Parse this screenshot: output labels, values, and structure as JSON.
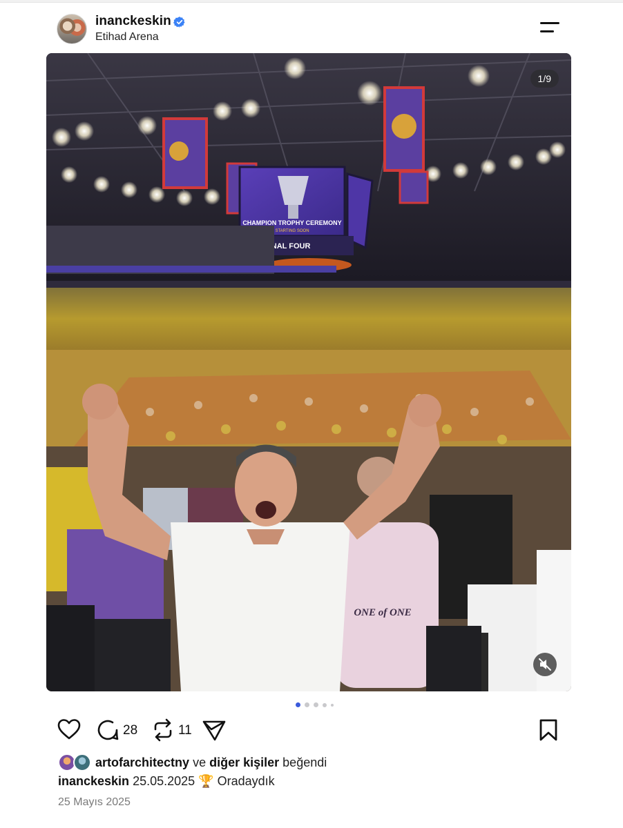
{
  "post": {
    "username": "inanckeskin",
    "location": "Etihad Arena",
    "verified": true,
    "media_counter": "1/9",
    "scoreboard_text": "CHAMPION TROPHY CEREMONY",
    "scoreboard_subtext": "STARTING SOON",
    "final_four_text": "FINAL FOUR",
    "shirt_text": "ONE of ONE",
    "carousel_active_index": 0,
    "carousel_dot_count": 5
  },
  "actions": {
    "like_icon": "heart-icon",
    "comment_icon": "comment-icon",
    "comment_count": "28",
    "repost_icon": "repost-icon",
    "repost_count": "11",
    "share_icon": "send-icon",
    "save_icon": "bookmark-icon"
  },
  "likes": {
    "first_user": "artofarchitectny",
    "connector": "ve",
    "others": "diğer kişiler",
    "suffix": "beğendi"
  },
  "caption": {
    "author": "inanckeskin",
    "text_before": "25.05.2025",
    "emoji": "🏆",
    "text_after": "Oradaydık"
  },
  "date_label": "25 Mayıs 2025",
  "colors": {
    "verified_blue": "#3b82f6",
    "active_dot": "#3b5bdb",
    "inactive_dot": "#c9c9cc"
  }
}
